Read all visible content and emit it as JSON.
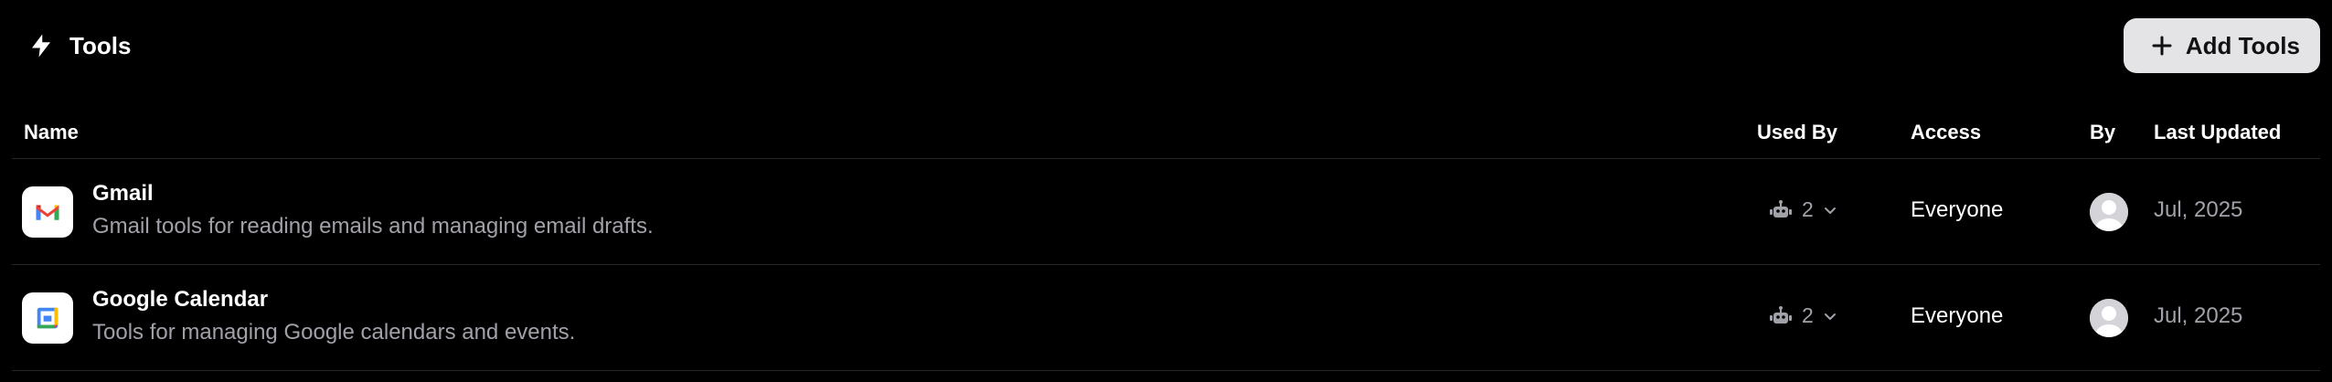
{
  "header": {
    "title": "Tools",
    "title_icon": "lightning-bolt-icon",
    "add_button_label": "Add Tools",
    "add_button_icon": "plus-icon"
  },
  "table": {
    "columns": {
      "name": "Name",
      "used_by": "Used By",
      "access": "Access",
      "by": "By",
      "last_updated": "Last Updated"
    },
    "rows": [
      {
        "icon": "gmail-icon",
        "name": "Gmail",
        "description": "Gmail tools for reading emails and managing email drafts.",
        "used_by_count": "2",
        "access": "Everyone",
        "by_icon": "user-avatar",
        "last_updated": "Jul, 2025"
      },
      {
        "icon": "google-calendar-icon",
        "name": "Google Calendar",
        "description": "Tools for managing Google calendars and events.",
        "used_by_count": "2",
        "access": "Everyone",
        "by_icon": "user-avatar",
        "last_updated": "Jul, 2025"
      }
    ]
  },
  "colors": {
    "background": "#000000",
    "button_bg": "#e4e4e7",
    "muted_text": "#a1a1aa",
    "divider": "#27272a"
  }
}
